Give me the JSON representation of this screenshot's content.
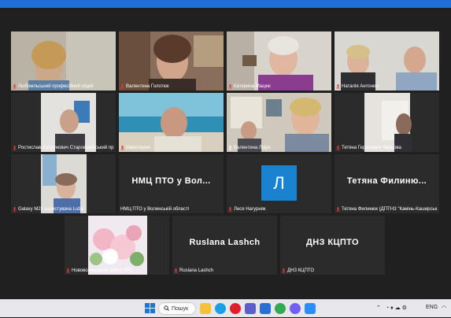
{
  "participants": [
    {
      "name": "Любомльський професійний ліцей"
    },
    {
      "name": "Валентина Голотюк"
    },
    {
      "name": "Катерина Мацюк"
    },
    {
      "name": "Наталія Антонюк"
    },
    {
      "name": "Ростислав Супрунович Старовижівський пр..."
    },
    {
      "name": "Майстерня"
    },
    {
      "name": "Валентина Лідух"
    },
    {
      "name": "Тетяна Герасимик-Чернова"
    },
    {
      "name": "Galaxy M21 користувача Luba"
    },
    {
      "name": "НМЦ ПТО у Волинській області",
      "display": "НМЦ ПТО у Вол..."
    },
    {
      "name": "Леся Нагурняк",
      "initial": "Л"
    },
    {
      "name": "Тетяна Филинюк (ДПТНЗ \"Камінь-Каширськ...",
      "display": "Тетяна Филиню..."
    },
    {
      "name": "Нововолинський центр ПТО"
    },
    {
      "name": "Ruslana Lashch",
      "display": "Ruslana Lashch"
    },
    {
      "name": "ДНЗ КЦПТО",
      "display": "ДНЗ КЦПТО"
    }
  ],
  "taskbar": {
    "search_label": "Пошук",
    "language": "ENG"
  },
  "colors": {
    "background": "#202020",
    "active_speaker": "#cfe25a",
    "avatar": "#1a83d1",
    "top_bar": "#1f6fd6"
  }
}
